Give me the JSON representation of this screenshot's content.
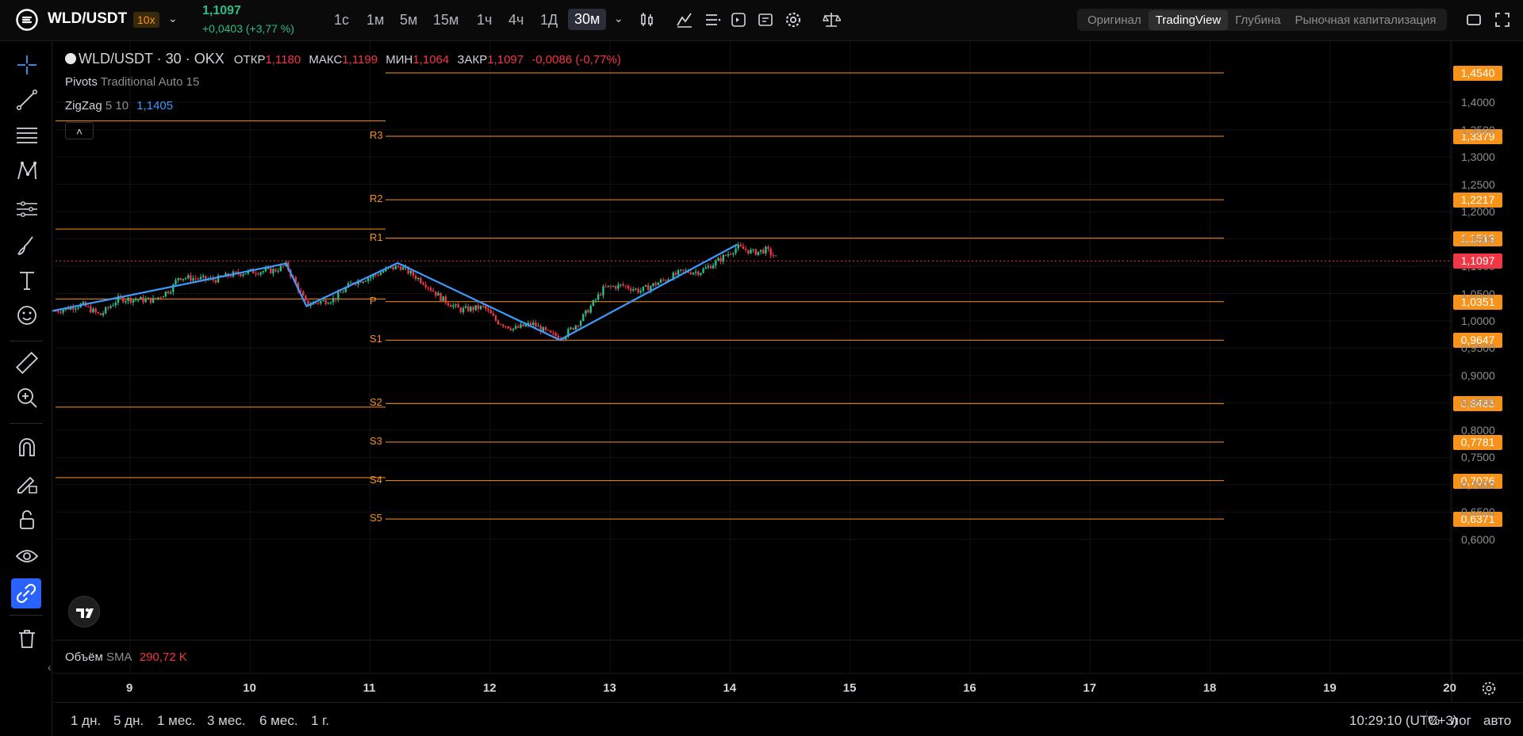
{
  "header": {
    "pair": "WLD/USDT",
    "leverage": "10x",
    "price": "1,1097",
    "change": "+0,0403 (+3,77 %)",
    "timeframes": [
      "1с",
      "1м",
      "5м",
      "15м",
      "1ч",
      "4ч",
      "1Д",
      "30м"
    ],
    "active_timeframe": "30м",
    "view_tabs": [
      "Оригинал",
      "TradingView",
      "Глубина",
      "Рыночная капитализация"
    ],
    "active_view": "TradingView"
  },
  "legend": {
    "symbol": "WLD/USDT · 30 · OKX",
    "open_label": "ОТКР",
    "open": "1,1180",
    "high_label": "МАКС",
    "high": "1,1199",
    "low_label": "МИН",
    "low": "1,1064",
    "close_label": "ЗАКР",
    "close": "1,1097",
    "change": "-0,0086 (-0,77%)",
    "pivots_name": "Pivots",
    "pivots_params": "Traditional Auto 15",
    "zigzag_name": "ZigZag",
    "zigzag_params": "5 10",
    "zigzag_value": "1,1405",
    "volume_name": "Объём",
    "volume_sma": "SMA",
    "volume_value": "290,72 K"
  },
  "price_axis": {
    "ticks": [
      "1,4000",
      "1,3500",
      "1,3000",
      "1,2500",
      "1,2000",
      "1,1500",
      "1,1000",
      "1,0500",
      "1,0000",
      "0,9500",
      "0,9000",
      "0,8500",
      "0,8000",
      "0,7500",
      "0,7000",
      "0,6500",
      "0,6000"
    ],
    "current_price": "1,1097"
  },
  "pivots": [
    {
      "name": "",
      "value": "1,4540"
    },
    {
      "name": "R3",
      "value": "1,3379"
    },
    {
      "name": "R2",
      "value": "1,2217"
    },
    {
      "name": "R1",
      "value": "1,1513"
    },
    {
      "name": "P",
      "value": "1,0351"
    },
    {
      "name": "S1",
      "value": "0,9647"
    },
    {
      "name": "S2",
      "value": "0,8485"
    },
    {
      "name": "S3",
      "value": "0,7781"
    },
    {
      "name": "S4",
      "value": "0,7076"
    },
    {
      "name": "S5",
      "value": "0,6371"
    }
  ],
  "date_axis": [
    "9",
    "10",
    "11",
    "12",
    "13",
    "14",
    "15",
    "16",
    "17",
    "18",
    "19",
    "20"
  ],
  "bottom": {
    "ranges": [
      "1 дн.",
      "5 дн.",
      "1 мес.",
      "3 мес.",
      "6 мес.",
      "1 г."
    ],
    "clock": "10:29:10 (UTC+3)",
    "percent": "%",
    "log": "лог",
    "auto": "авто"
  },
  "colors": {
    "up": "#2ebd85",
    "down": "#f23645",
    "pivot": "#f7931a",
    "zigzag": "#3c9bff"
  },
  "chart_data": {
    "type": "candlestick",
    "title": "",
    "series": [
      {
        "name": "ZigZag",
        "points": [
          {
            "x": 8.35,
            "y": 1.018
          },
          {
            "x": 10.3,
            "y": 1.105
          },
          {
            "x": 10.47,
            "y": 1.027
          },
          {
            "x": 11.23,
            "y": 1.106
          },
          {
            "x": 12.58,
            "y": 0.965
          },
          {
            "x": 14.06,
            "y": 1.14
          }
        ]
      }
    ],
    "pivot_levels": [
      1.454,
      1.3379,
      1.2217,
      1.1513,
      1.0351,
      0.9647,
      0.8485,
      0.7781,
      0.7076,
      0.6371
    ],
    "prev_period_levels": [
      1.366,
      1.168,
      1.04,
      0.842,
      0.713
    ],
    "x_range": [
      8.4,
      20.0
    ],
    "y_range": [
      0.59,
      1.46
    ],
    "close_price": 1.1097,
    "price_path": [
      [
        8.38,
        1.018
      ],
      [
        8.6,
        1.03
      ],
      [
        8.75,
        1.01
      ],
      [
        8.9,
        1.04
      ],
      [
        9.2,
        1.038
      ],
      [
        9.35,
        1.06
      ],
      [
        9.4,
        1.08
      ],
      [
        9.7,
        1.075
      ],
      [
        9.85,
        1.085
      ],
      [
        10.0,
        1.09
      ],
      [
        10.2,
        1.092
      ],
      [
        10.3,
        1.102
      ],
      [
        10.4,
        1.06
      ],
      [
        10.47,
        1.03
      ],
      [
        10.7,
        1.04
      ],
      [
        10.85,
        1.07
      ],
      [
        11.0,
        1.08
      ],
      [
        11.15,
        1.095
      ],
      [
        11.25,
        1.1
      ],
      [
        11.45,
        1.07
      ],
      [
        11.6,
        1.04
      ],
      [
        11.75,
        1.02
      ],
      [
        11.95,
        1.025
      ],
      [
        12.05,
        1.0
      ],
      [
        12.2,
        0.985
      ],
      [
        12.35,
        0.995
      ],
      [
        12.5,
        0.975
      ],
      [
        12.6,
        0.97
      ],
      [
        12.75,
        1.0
      ],
      [
        12.85,
        1.03
      ],
      [
        12.95,
        1.06
      ],
      [
        13.1,
        1.065
      ],
      [
        13.25,
        1.055
      ],
      [
        13.4,
        1.07
      ],
      [
        13.6,
        1.09
      ],
      [
        13.75,
        1.09
      ],
      [
        13.9,
        1.11
      ],
      [
        14.06,
        1.135
      ],
      [
        14.2,
        1.125
      ],
      [
        14.3,
        1.13
      ],
      [
        14.4,
        1.112
      ]
    ]
  }
}
